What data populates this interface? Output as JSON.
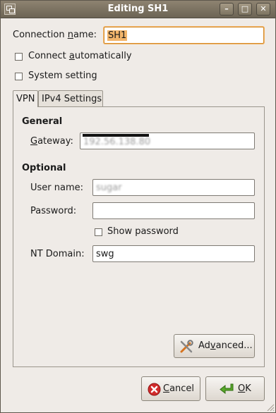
{
  "window": {
    "title": "Editing SH1",
    "minimize_glyph": "–",
    "maximize_glyph": "□",
    "close_glyph": "✕"
  },
  "connection_name": {
    "label_pre": "Connection ",
    "label_mnemonic": "n",
    "label_post": "ame:",
    "value": "SH1"
  },
  "connect_automatically": {
    "label_pre": "Connect ",
    "label_mnemonic": "a",
    "label_post": "utomatically",
    "checked": false
  },
  "system_setting": {
    "label": "System setting",
    "checked": false
  },
  "tabs": [
    {
      "label": "VPN",
      "active": true
    },
    {
      "label": "IPv4 Settings",
      "active": false
    }
  ],
  "vpn": {
    "general_heading": "General",
    "gateway": {
      "label_mnemonic": "G",
      "label_post": "ateway:",
      "value": "192.56.138.80"
    },
    "optional_heading": "Optional",
    "user_name": {
      "label": "User name:",
      "value": "sugar"
    },
    "password": {
      "label": "Password:",
      "value": ""
    },
    "show_password": {
      "label": "Show password",
      "checked": false
    },
    "nt_domain": {
      "label": "NT Domain:",
      "value": "swg"
    },
    "advanced_button": {
      "label_pre": "Ad",
      "label_mnemonic": "v",
      "label_post": "anced..."
    }
  },
  "buttons": {
    "cancel": {
      "label_mnemonic": "C",
      "label_post": "ancel"
    },
    "ok": {
      "label_mnemonic": "O",
      "label_post": "K"
    }
  },
  "colors": {
    "titlebar": "#7d7461",
    "focus": "#d48c2c",
    "cancel_icon": "#d12b2b",
    "ok_icon": "#5aa82a"
  }
}
